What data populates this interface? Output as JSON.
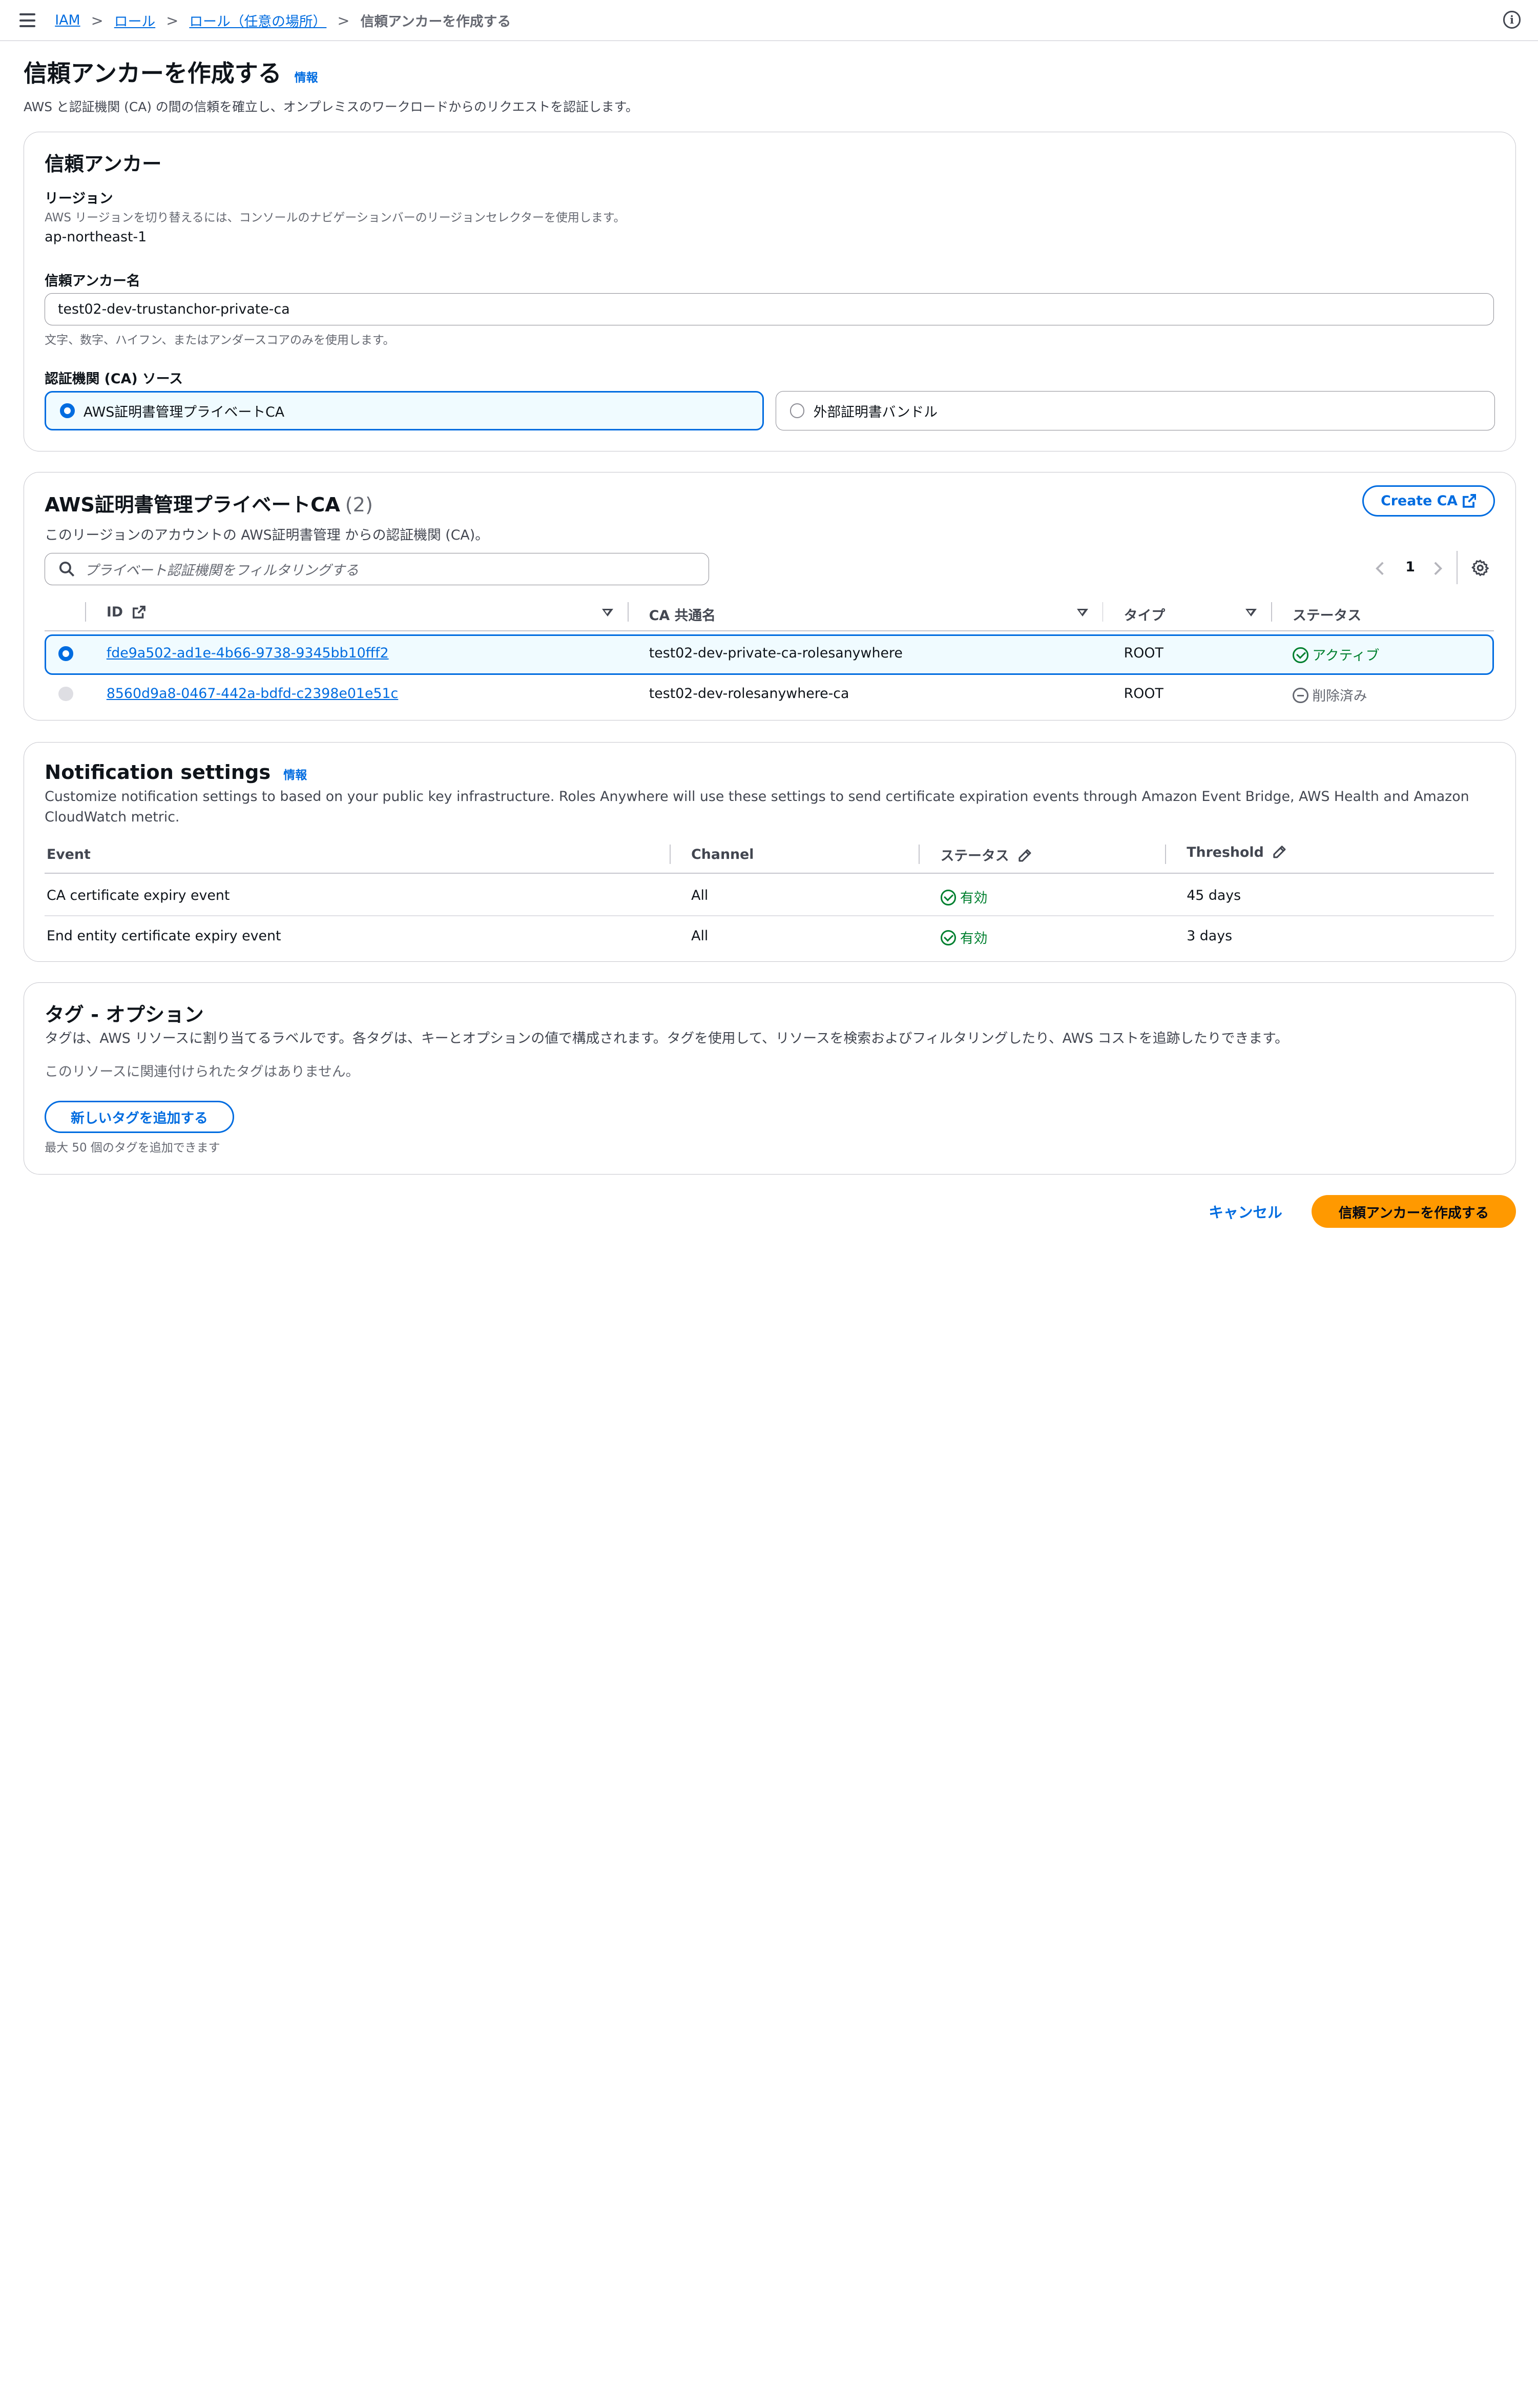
{
  "breadcrumb": {
    "items": [
      "IAM",
      "ロール",
      "ロール（任意の場所）"
    ],
    "current": "信頼アンカーを作成する"
  },
  "page": {
    "title": "信頼アンカーを作成する",
    "info": "情報",
    "description": "AWS と認証機関 (CA) の間の信頼を確立し、オンプレミスのワークロードからのリクエストを認証します。"
  },
  "anchor": {
    "title": "信頼アンカー",
    "region_label": "リージョン",
    "region_hint": "AWS リージョンを切り替えるには、コンソールのナビゲーションバーのリージョンセレクターを使用します。",
    "region_value": "ap-northeast-1",
    "name_label": "信頼アンカー名",
    "name_value": "test02-dev-trustanchor-private-ca",
    "name_hint": "文字、数字、ハイフン、またはアンダースコアのみを使用します。",
    "source_label": "認証機関 (CA) ソース",
    "source_options": [
      "AWS証明書管理プライベートCA",
      "外部証明書バンドル"
    ],
    "source_selected": "AWS証明書管理プライベートCA"
  },
  "ca_table": {
    "title": "AWS証明書管理プライベートCA",
    "count": "(2)",
    "description": "このリージョンのアカウントの AWS証明書管理 からの認証機関 (CA)。",
    "create_button": "Create CA",
    "filter_placeholder": "プライベート認証機関をフィルタリングする",
    "page": "1",
    "columns": [
      "ID",
      "CA 共通名",
      "タイプ",
      "ステータス"
    ],
    "rows": [
      {
        "id": "fde9a502-ad1e-4b66-9738-9345bb10fff2",
        "name": "test02-dev-private-ca-rolesanywhere",
        "type": "ROOT",
        "status": "アクティブ"
      },
      {
        "id": "8560d9a8-0467-442a-bdfd-c2398e01e51c",
        "name": "test02-dev-rolesanywhere-ca",
        "type": "ROOT",
        "status": "削除済み"
      }
    ]
  },
  "notifications": {
    "title": "Notification settings",
    "info": "情報",
    "description": "Customize notification settings to based on your public key infrastructure. Roles Anywhere will use these settings to send certificate expiration events through Amazon Event Bridge, AWS Health and Amazon CloudWatch metric.",
    "columns": [
      "Event",
      "Channel",
      "ステータス",
      "Threshold"
    ],
    "rows": [
      {
        "event": "CA certificate expiry event",
        "channel": "All",
        "status": "有効",
        "threshold": "45 days"
      },
      {
        "event": "End entity certificate expiry event",
        "channel": "All",
        "status": "有効",
        "threshold": "3 days"
      }
    ]
  },
  "tags": {
    "title": "タグ - オプション",
    "description": "タグは、AWS リソースに割り当てるラベルです。各タグは、キーとオプションの値で構成されます。タグを使用して、リソースを検索およびフィルタリングしたり、AWS コストを追跡したりできます。",
    "empty": "このリソースに関連付けられたタグはありません。",
    "add_button": "新しいタグを追加する",
    "limit": "最大 50 個のタグを追加できます"
  },
  "footer": {
    "cancel": "キャンセル",
    "submit": "信頼アンカーを作成する"
  },
  "colors": {
    "accent": "#006ce0",
    "primary_button": "#ff9900",
    "success": "#00802f",
    "selected_bg": "#f0fbff"
  }
}
